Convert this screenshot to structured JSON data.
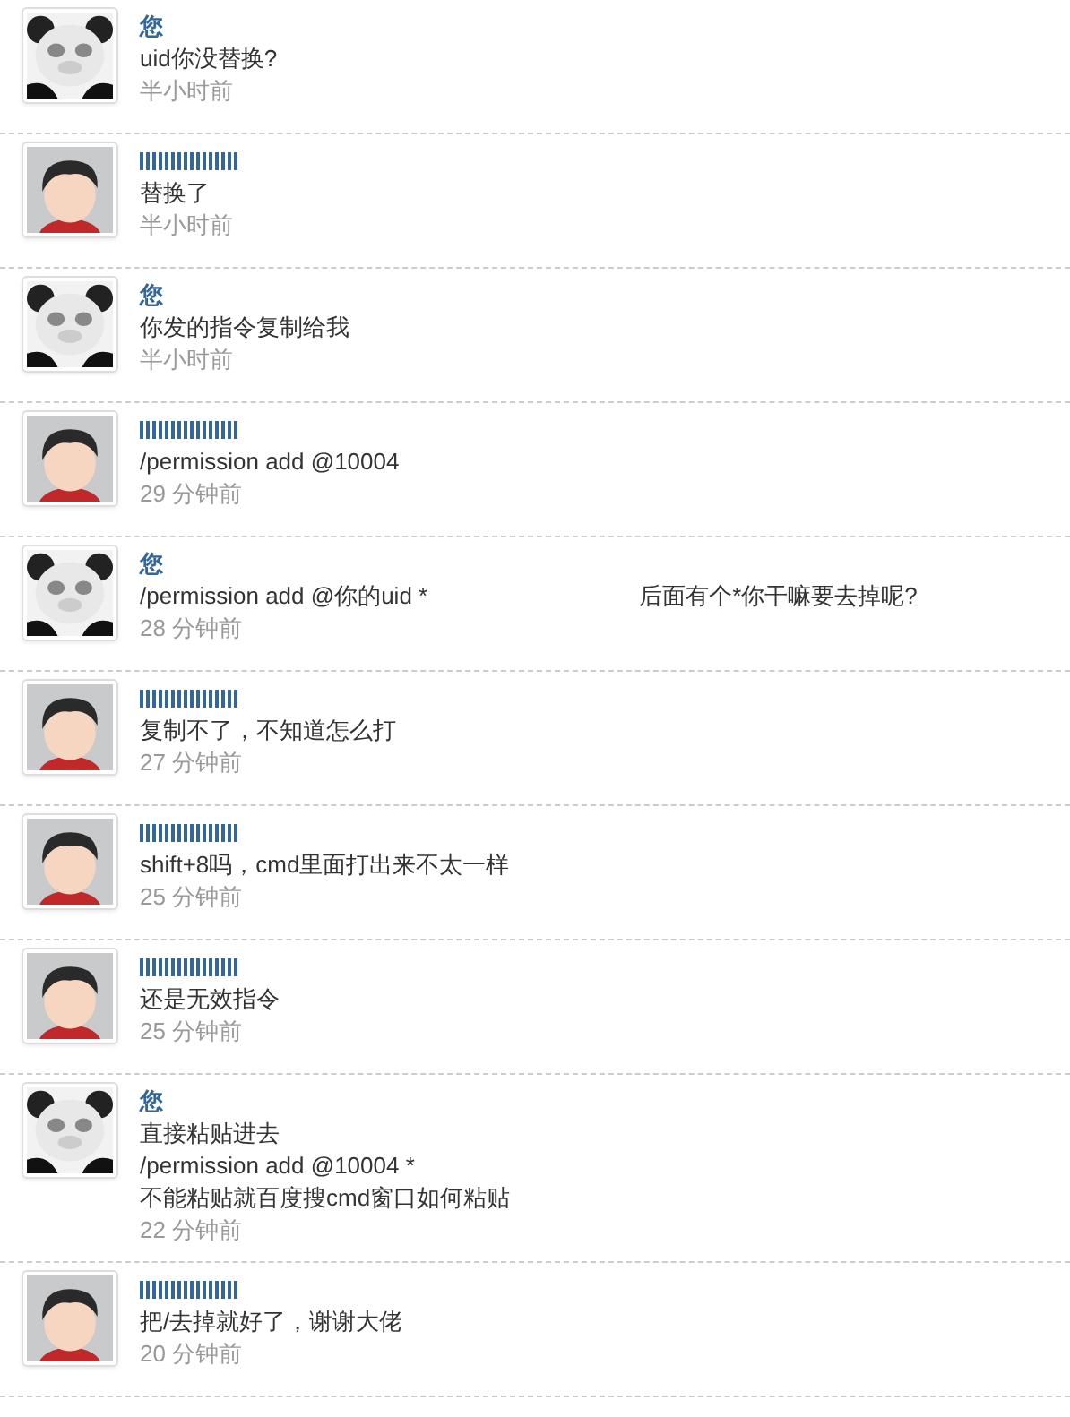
{
  "messages": [
    {
      "avatar": {
        "kind": "panda"
      },
      "author": {
        "kind": "you",
        "name": "您"
      },
      "lines": [
        "uid你没替换?"
      ],
      "time": "半小时前"
    },
    {
      "avatar": {
        "kind": "boy"
      },
      "author": {
        "kind": "redacted"
      },
      "lines": [
        "替换了"
      ],
      "time": "半小时前"
    },
    {
      "avatar": {
        "kind": "panda"
      },
      "author": {
        "kind": "you",
        "name": "您"
      },
      "lines": [
        "你发的指令复制给我"
      ],
      "time": "半小时前"
    },
    {
      "avatar": {
        "kind": "boy"
      },
      "author": {
        "kind": "redacted"
      },
      "lines": [
        "/permission add @10004"
      ],
      "time": "29 分钟前"
    },
    {
      "avatar": {
        "kind": "panda"
      },
      "author": {
        "kind": "you",
        "name": "您"
      },
      "lines": [
        "/permission add @你的uid *"
      ],
      "note": "后面有个*你干嘛要去掉呢?",
      "time": "28 分钟前"
    },
    {
      "avatar": {
        "kind": "boy"
      },
      "author": {
        "kind": "redacted"
      },
      "lines": [
        "复制不了，不知道怎么打"
      ],
      "time": "27 分钟前"
    },
    {
      "avatar": {
        "kind": "boy"
      },
      "author": {
        "kind": "redacted"
      },
      "lines": [
        "shift+8吗，cmd里面打出来不太一样"
      ],
      "time": "25 分钟前"
    },
    {
      "avatar": {
        "kind": "boy"
      },
      "author": {
        "kind": "redacted"
      },
      "lines": [
        "还是无效指令"
      ],
      "time": "25 分钟前"
    },
    {
      "avatar": {
        "kind": "panda"
      },
      "author": {
        "kind": "you",
        "name": "您"
      },
      "lines": [
        "直接粘贴进去",
        "/permission add @10004 *",
        "不能粘贴就百度搜cmd窗口如何粘贴"
      ],
      "time": "22 分钟前"
    },
    {
      "avatar": {
        "kind": "boy"
      },
      "author": {
        "kind": "redacted"
      },
      "lines": [
        "把/去掉就好了，谢谢大佬"
      ],
      "time": "20 分钟前"
    }
  ]
}
